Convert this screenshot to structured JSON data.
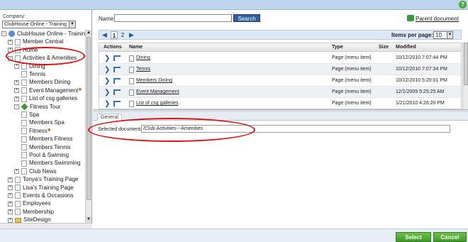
{
  "help": {
    "icon": "help-icon",
    "glyph": "?"
  },
  "left": {
    "company_label": "Company:",
    "company_value": "ClubHouse Online - Training",
    "tree": [
      {
        "label": "ClubHouse Online - Training",
        "indent": 0,
        "toggle": "-",
        "icon": "globe"
      },
      {
        "label": "Member Central",
        "indent": 1,
        "toggle": "+",
        "icon": "doc"
      },
      {
        "label": "Home",
        "indent": 1,
        "toggle": "+",
        "icon": "doc"
      },
      {
        "label": "Activities & Amenities",
        "indent": 1,
        "toggle": "-",
        "icon": "doc",
        "selected": true
      },
      {
        "label": "Dining",
        "indent": 2,
        "toggle": "+",
        "icon": "doc"
      },
      {
        "label": "Tennis",
        "indent": 2,
        "toggle": "",
        "icon": "doc"
      },
      {
        "label": "Members Dining",
        "indent": 2,
        "toggle": "+",
        "icon": "doc"
      },
      {
        "label": "Event Management",
        "indent": 2,
        "toggle": "+",
        "icon": "doc",
        "star": true
      },
      {
        "label": "List of csg galleries",
        "indent": 2,
        "toggle": "+",
        "icon": "doc"
      },
      {
        "label": "Fitness Tour",
        "indent": 2,
        "toggle": "-",
        "icon": "diamond"
      },
      {
        "label": "Spa",
        "indent": 2,
        "toggle": "",
        "icon": "doc"
      },
      {
        "label": "Members Spa",
        "indent": 2,
        "toggle": "",
        "icon": "doc"
      },
      {
        "label": "Fitness",
        "indent": 2,
        "toggle": "",
        "icon": "doc",
        "star": true
      },
      {
        "label": "Members Fitness",
        "indent": 2,
        "toggle": "",
        "icon": "doc"
      },
      {
        "label": "Members Tennis",
        "indent": 2,
        "toggle": "",
        "icon": "doc"
      },
      {
        "label": "Pool & Swiming",
        "indent": 2,
        "toggle": "",
        "icon": "doc"
      },
      {
        "label": "Members Swimming",
        "indent": 2,
        "toggle": "",
        "icon": "doc"
      },
      {
        "label": "Club News",
        "indent": 2,
        "toggle": "+",
        "icon": "doc"
      },
      {
        "label": "Tonya's Training Page",
        "indent": 1,
        "toggle": "+",
        "icon": "doc"
      },
      {
        "label": "Lisa's Training Page",
        "indent": 1,
        "toggle": "+",
        "icon": "doc"
      },
      {
        "label": "Events & Occasions",
        "indent": 1,
        "toggle": "+",
        "icon": "doc"
      },
      {
        "label": "Employees",
        "indent": 1,
        "toggle": "+",
        "icon": "doc"
      },
      {
        "label": "Membership",
        "indent": 1,
        "toggle": "+",
        "icon": "doc"
      },
      {
        "label": "SiteDesign",
        "indent": 1,
        "toggle": "+",
        "icon": "folder"
      }
    ]
  },
  "search": {
    "name_label": "Name:",
    "name_value": "",
    "button_label": "Search",
    "parent_label": "Parent document"
  },
  "pager": {
    "prev": "◀",
    "next": "▶",
    "pages": [
      "1",
      "2"
    ],
    "current": "1",
    "items_per_page_label": "Items per page:",
    "items_per_page_value": "10"
  },
  "grid": {
    "columns": [
      "Actions",
      "Name",
      "Type",
      "Size",
      "Modified"
    ],
    "rows": [
      {
        "name": "Dining",
        "type": "Page (menu item)",
        "size": "",
        "modified": "10/12/2010 7:07:44 PM"
      },
      {
        "name": "Tennis",
        "type": "Page (menu item)",
        "size": "",
        "modified": "10/12/2010 7:07:34 PM"
      },
      {
        "name": "Members Dining",
        "type": "Page (menu item)",
        "size": "",
        "modified": "10/12/2010 5:20:01 PM"
      },
      {
        "name": "Event Management",
        "type": "Page (menu item)",
        "size": "",
        "modified": "12/1/2009 5:25:25 AM"
      },
      {
        "name": "List of csg galleries",
        "type": "Page (menu item)",
        "size": "",
        "modified": "1/21/2010 4:26:20 PM"
      }
    ]
  },
  "properties": {
    "tab_label": "General",
    "selected_label": "Selected document:",
    "selected_value": "/Club-Activities---Amenities"
  },
  "footer": {
    "select_label": "Select",
    "cancel_label": "Cancel"
  },
  "colors": {
    "accent": "#2f5f9f",
    "annotation": "#e01010",
    "button_green": "#3f9d27"
  }
}
